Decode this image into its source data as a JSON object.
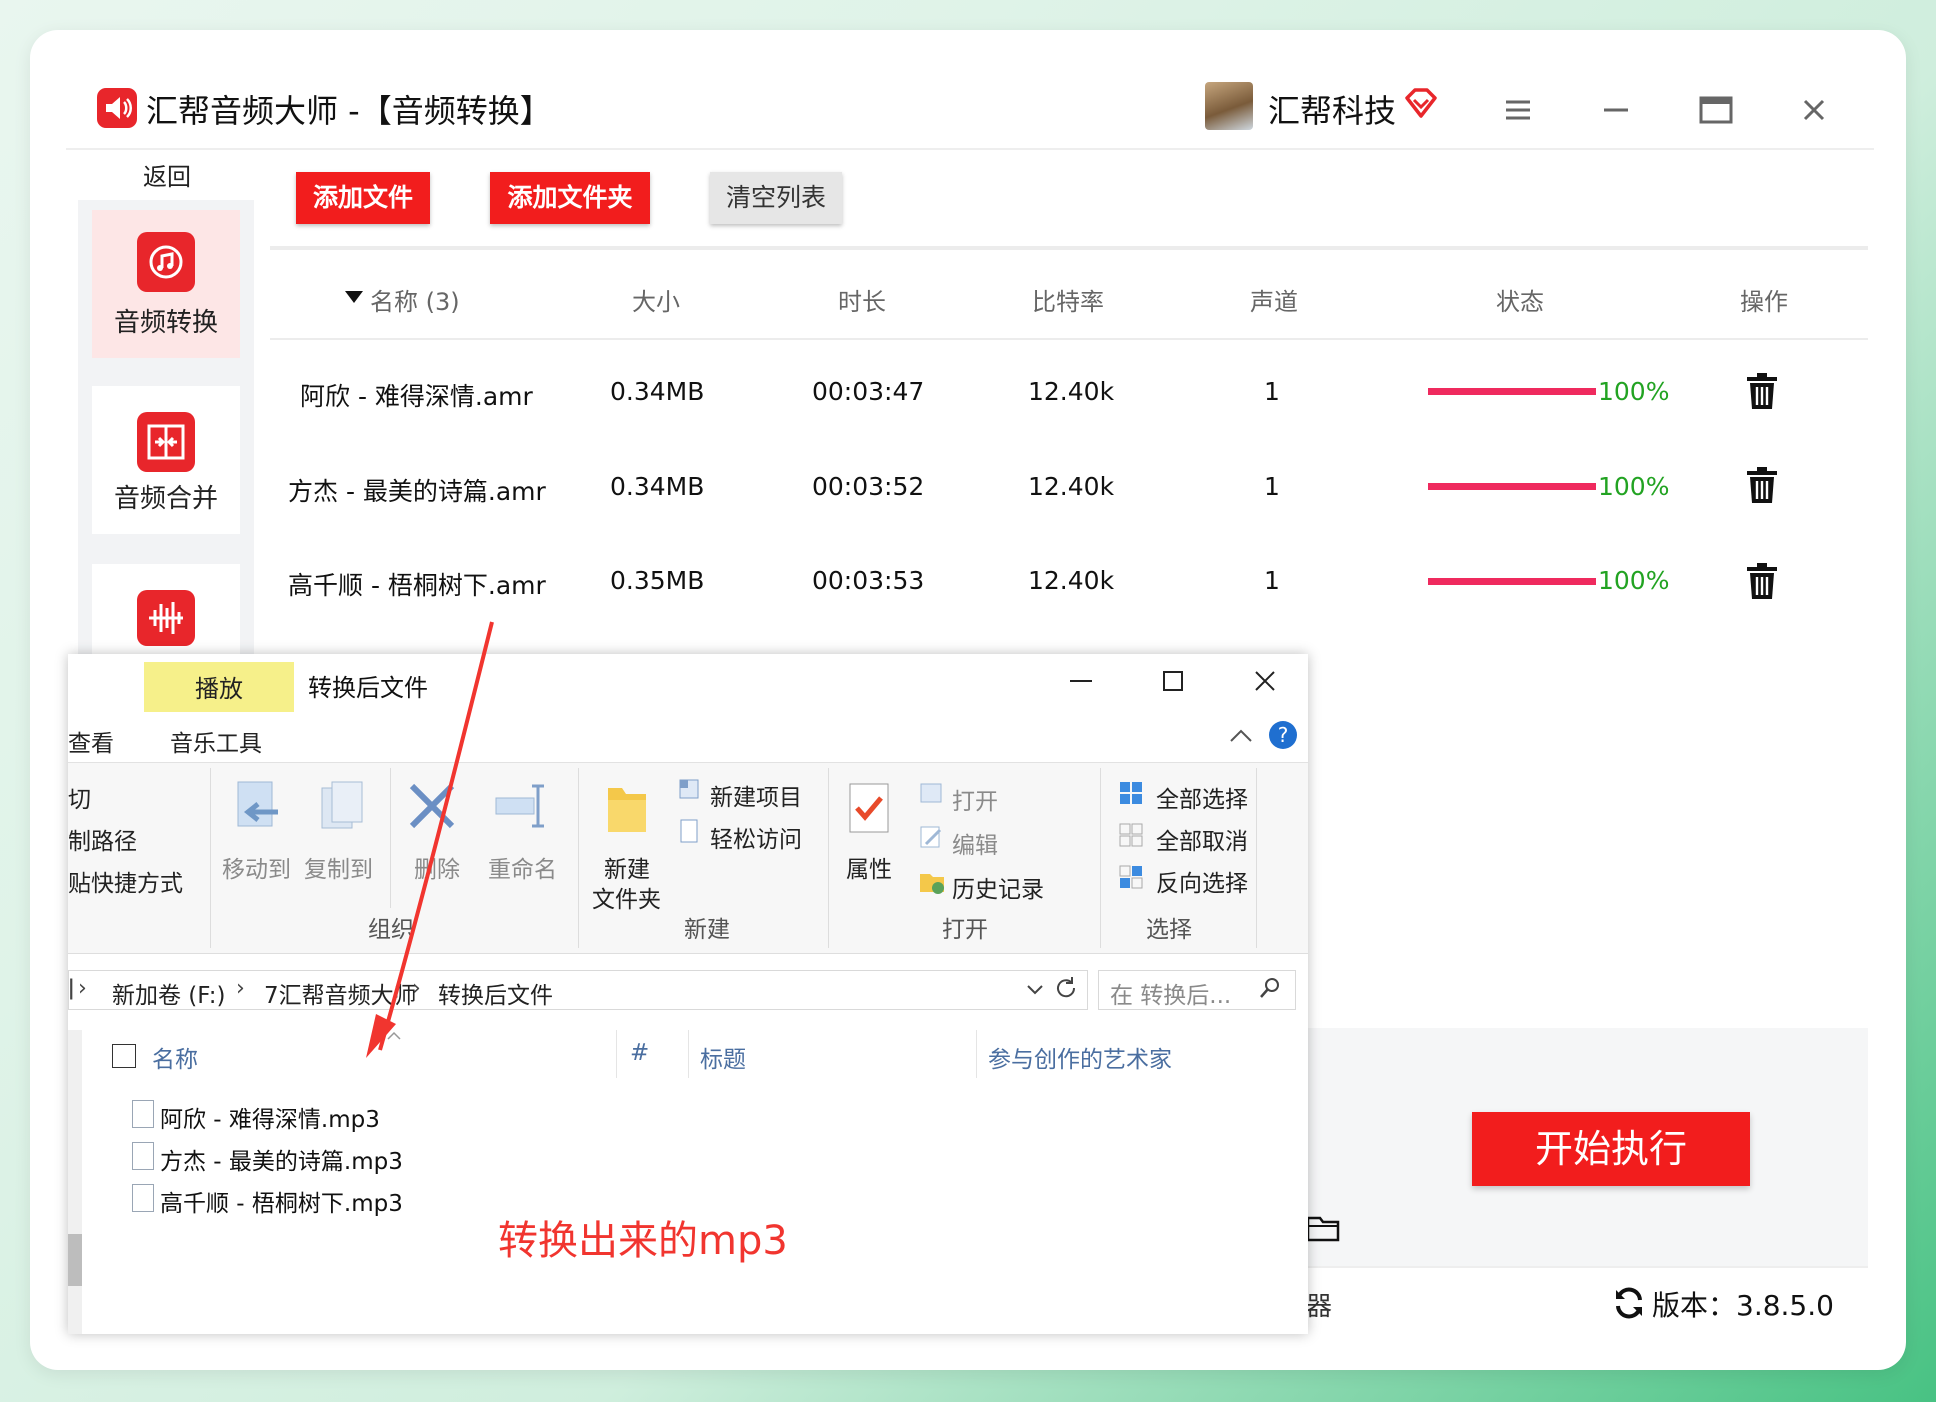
{
  "app": {
    "title": "汇帮音频大师  -【音频转换】",
    "user_name": "汇帮科技",
    "version": "版本：3.8.5.0"
  },
  "sidebar": {
    "back_label": "返回",
    "items": [
      {
        "label": "音频转换",
        "active": true
      },
      {
        "label": "音频合并",
        "active": false
      },
      {
        "label": "",
        "active": false
      }
    ]
  },
  "toolbar": {
    "add_file": "添加文件",
    "add_folder": "添加文件夹",
    "clear_list": "清空列表"
  },
  "table": {
    "columns": [
      "名称 (3)",
      "大小",
      "时长",
      "比特率",
      "声道",
      "状态",
      "操作"
    ],
    "rows": [
      {
        "name": "阿欣 - 难得深情.amr",
        "size": "0.34MB",
        "duration": "00:03:47",
        "bitrate": "12.40k",
        "channels": "1",
        "progress": 1.0,
        "status": "100%"
      },
      {
        "name": "方杰 - 最美的诗篇.amr",
        "size": "0.34MB",
        "duration": "00:03:52",
        "bitrate": "12.40k",
        "channels": "1",
        "progress": 1.0,
        "status": "100%"
      },
      {
        "name": "高千顺 - 梧桐树下.amr",
        "size": "0.35MB",
        "duration": "00:03:53",
        "bitrate": "12.40k",
        "channels": "1",
        "progress": 1.0,
        "status": "100%"
      }
    ]
  },
  "start_button": "开始执行",
  "footer_partial": "器",
  "explorer": {
    "title": "转换后文件",
    "tabs": {
      "play": "播放",
      "view": "查看",
      "music_tools": "音乐工具"
    },
    "clipboard_partial": [
      "切",
      "制路径",
      "贴快捷方式"
    ],
    "organize": {
      "move_to": "移动到",
      "copy_to": "复制到",
      "delete": "删除",
      "rename": "重命名",
      "group": "组织"
    },
    "new": {
      "new_folder_line1": "新建",
      "new_folder_line2": "文件夹",
      "new_item": "新建项目",
      "easy_access": "轻松访问",
      "group": "新建"
    },
    "open": {
      "properties": "属性",
      "open": "打开",
      "edit": "编辑",
      "history": "历史记录",
      "group": "打开"
    },
    "select": {
      "select_all": "全部选择",
      "select_none": "全部取消",
      "invert": "反向选择",
      "group": "选择"
    },
    "breadcrumb": [
      "新加卷 (F:)",
      "7汇帮音频大师",
      "转换后文件"
    ],
    "search_placeholder": "在 转换后...",
    "columns": [
      "名称",
      "#",
      "标题",
      "参与创作的艺术家"
    ],
    "files": [
      "阿欣 - 难得深情.mp3",
      "方杰 - 最美的诗篇.mp3",
      "高千顺 - 梧桐树下.mp3"
    ]
  },
  "annotation": "转换出来的mp3",
  "colors": {
    "brand_red": "#f21d1d",
    "progress": "#ef2a5e",
    "status_green": "#22a322",
    "annotation": "#f1352f"
  }
}
